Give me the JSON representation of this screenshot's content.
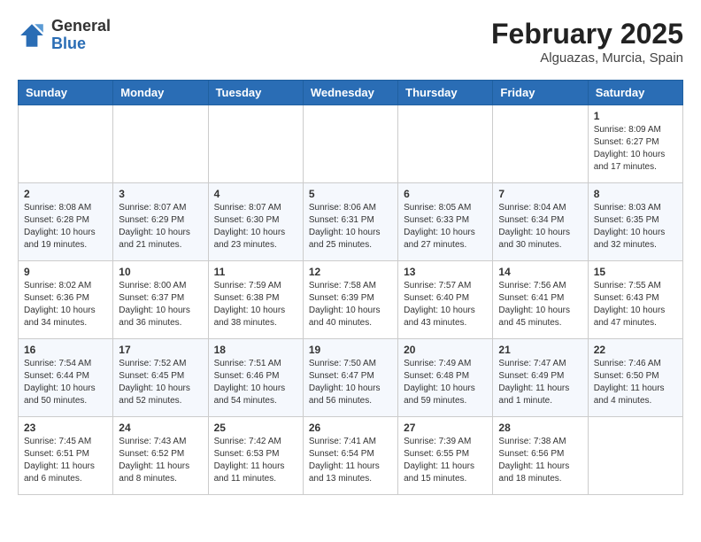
{
  "header": {
    "logo": {
      "general": "General",
      "blue": "Blue"
    },
    "title": "February 2025",
    "location": "Alguazas, Murcia, Spain"
  },
  "weekdays": [
    "Sunday",
    "Monday",
    "Tuesday",
    "Wednesday",
    "Thursday",
    "Friday",
    "Saturday"
  ],
  "weeks": [
    [
      {
        "day": "",
        "info": ""
      },
      {
        "day": "",
        "info": ""
      },
      {
        "day": "",
        "info": ""
      },
      {
        "day": "",
        "info": ""
      },
      {
        "day": "",
        "info": ""
      },
      {
        "day": "",
        "info": ""
      },
      {
        "day": "1",
        "info": "Sunrise: 8:09 AM\nSunset: 6:27 PM\nDaylight: 10 hours\nand 17 minutes."
      }
    ],
    [
      {
        "day": "2",
        "info": "Sunrise: 8:08 AM\nSunset: 6:28 PM\nDaylight: 10 hours\nand 19 minutes."
      },
      {
        "day": "3",
        "info": "Sunrise: 8:07 AM\nSunset: 6:29 PM\nDaylight: 10 hours\nand 21 minutes."
      },
      {
        "day": "4",
        "info": "Sunrise: 8:07 AM\nSunset: 6:30 PM\nDaylight: 10 hours\nand 23 minutes."
      },
      {
        "day": "5",
        "info": "Sunrise: 8:06 AM\nSunset: 6:31 PM\nDaylight: 10 hours\nand 25 minutes."
      },
      {
        "day": "6",
        "info": "Sunrise: 8:05 AM\nSunset: 6:33 PM\nDaylight: 10 hours\nand 27 minutes."
      },
      {
        "day": "7",
        "info": "Sunrise: 8:04 AM\nSunset: 6:34 PM\nDaylight: 10 hours\nand 30 minutes."
      },
      {
        "day": "8",
        "info": "Sunrise: 8:03 AM\nSunset: 6:35 PM\nDaylight: 10 hours\nand 32 minutes."
      }
    ],
    [
      {
        "day": "9",
        "info": "Sunrise: 8:02 AM\nSunset: 6:36 PM\nDaylight: 10 hours\nand 34 minutes."
      },
      {
        "day": "10",
        "info": "Sunrise: 8:00 AM\nSunset: 6:37 PM\nDaylight: 10 hours\nand 36 minutes."
      },
      {
        "day": "11",
        "info": "Sunrise: 7:59 AM\nSunset: 6:38 PM\nDaylight: 10 hours\nand 38 minutes."
      },
      {
        "day": "12",
        "info": "Sunrise: 7:58 AM\nSunset: 6:39 PM\nDaylight: 10 hours\nand 40 minutes."
      },
      {
        "day": "13",
        "info": "Sunrise: 7:57 AM\nSunset: 6:40 PM\nDaylight: 10 hours\nand 43 minutes."
      },
      {
        "day": "14",
        "info": "Sunrise: 7:56 AM\nSunset: 6:41 PM\nDaylight: 10 hours\nand 45 minutes."
      },
      {
        "day": "15",
        "info": "Sunrise: 7:55 AM\nSunset: 6:43 PM\nDaylight: 10 hours\nand 47 minutes."
      }
    ],
    [
      {
        "day": "16",
        "info": "Sunrise: 7:54 AM\nSunset: 6:44 PM\nDaylight: 10 hours\nand 50 minutes."
      },
      {
        "day": "17",
        "info": "Sunrise: 7:52 AM\nSunset: 6:45 PM\nDaylight: 10 hours\nand 52 minutes."
      },
      {
        "day": "18",
        "info": "Sunrise: 7:51 AM\nSunset: 6:46 PM\nDaylight: 10 hours\nand 54 minutes."
      },
      {
        "day": "19",
        "info": "Sunrise: 7:50 AM\nSunset: 6:47 PM\nDaylight: 10 hours\nand 56 minutes."
      },
      {
        "day": "20",
        "info": "Sunrise: 7:49 AM\nSunset: 6:48 PM\nDaylight: 10 hours\nand 59 minutes."
      },
      {
        "day": "21",
        "info": "Sunrise: 7:47 AM\nSunset: 6:49 PM\nDaylight: 11 hours\nand 1 minute."
      },
      {
        "day": "22",
        "info": "Sunrise: 7:46 AM\nSunset: 6:50 PM\nDaylight: 11 hours\nand 4 minutes."
      }
    ],
    [
      {
        "day": "23",
        "info": "Sunrise: 7:45 AM\nSunset: 6:51 PM\nDaylight: 11 hours\nand 6 minutes."
      },
      {
        "day": "24",
        "info": "Sunrise: 7:43 AM\nSunset: 6:52 PM\nDaylight: 11 hours\nand 8 minutes."
      },
      {
        "day": "25",
        "info": "Sunrise: 7:42 AM\nSunset: 6:53 PM\nDaylight: 11 hours\nand 11 minutes."
      },
      {
        "day": "26",
        "info": "Sunrise: 7:41 AM\nSunset: 6:54 PM\nDaylight: 11 hours\nand 13 minutes."
      },
      {
        "day": "27",
        "info": "Sunrise: 7:39 AM\nSunset: 6:55 PM\nDaylight: 11 hours\nand 15 minutes."
      },
      {
        "day": "28",
        "info": "Sunrise: 7:38 AM\nSunset: 6:56 PM\nDaylight: 11 hours\nand 18 minutes."
      },
      {
        "day": "",
        "info": ""
      }
    ]
  ]
}
